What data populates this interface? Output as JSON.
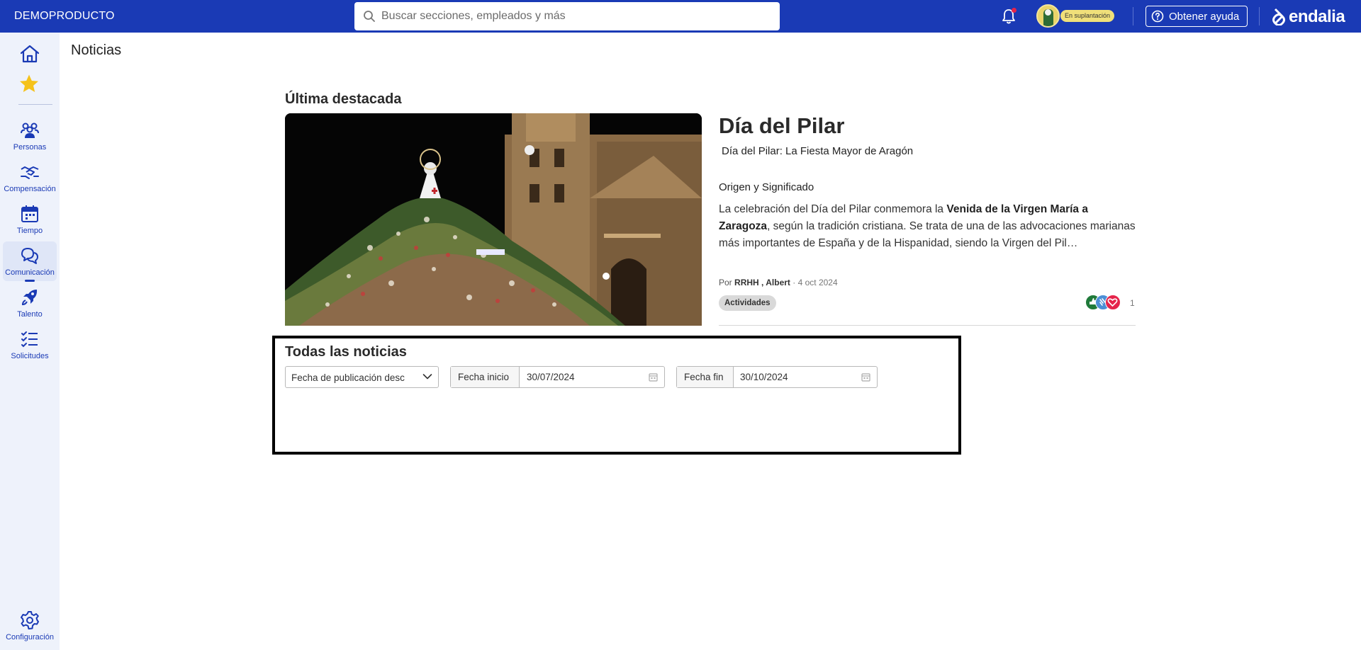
{
  "topbar": {
    "brand": "DEMOPRODUCTO",
    "search_placeholder": "Buscar secciones, empleados y más",
    "impersonation_badge": "En suplantación",
    "help_label": "Obtener ayuda",
    "logo_text": "endalia"
  },
  "sidebar": {
    "items": [
      {
        "label": "Personas",
        "icon": "people-icon"
      },
      {
        "label": "Compensación",
        "icon": "handshake-icon"
      },
      {
        "label": "Tiempo",
        "icon": "calendar-icon"
      },
      {
        "label": "Comunicación",
        "icon": "chat-icon"
      },
      {
        "label": "Talento",
        "icon": "rocket-icon"
      },
      {
        "label": "Solicitudes",
        "icon": "checklist-icon"
      }
    ],
    "settings_label": "Configuración",
    "active_item": "Comunicación"
  },
  "main": {
    "page_title": "Noticias",
    "featured_heading": "Última destacada",
    "article": {
      "title": "Día del Pilar",
      "subtitle": "Día del Pilar: La Fiesta Mayor de Aragón",
      "section_heading": "Origen y Significado",
      "body_1": "La celebración del Día del Pilar conmemora la ",
      "body_bold": "Venida de la Virgen María a Zaragoza",
      "body_2": ", según la tradición cristiana. Se trata de una de las advocaciones marianas más importantes de España y de la Hispanidad, siendo la Virgen del Pil…",
      "by_prefix": "Por",
      "author": "RRHH , Albert",
      "date": "· 4 oct 2024",
      "tag": "Actividades",
      "reaction_count": "1"
    },
    "all_news": {
      "heading": "Todas las noticias",
      "sort_select": "Fecha de publicación desc",
      "start_label": "Fecha inicio",
      "start_value": "30/07/2024",
      "end_label": "Fecha fin",
      "end_value": "30/10/2024"
    }
  },
  "colors": {
    "primary": "#1a3ab5",
    "sidebar_bg": "#eef2fb",
    "star": "#f5c21b",
    "notification_dot": "#e5244b"
  }
}
